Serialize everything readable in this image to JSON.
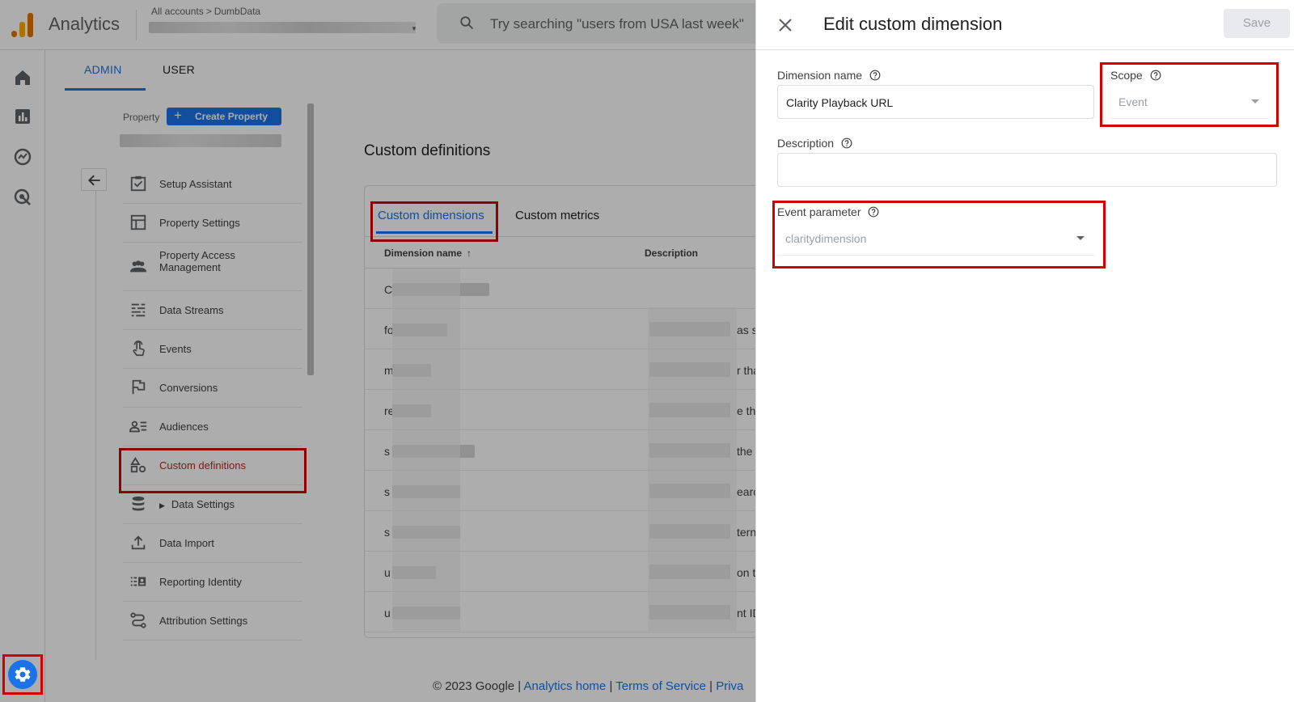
{
  "app": {
    "title": "Analytics",
    "breadcrumb": [
      "All accounts",
      "DumbData"
    ],
    "breadcrumb_sep": ">",
    "search_placeholder": "Try searching \"users from USA last week\""
  },
  "admin_tabs": [
    "ADMIN",
    "USER"
  ],
  "property": {
    "label": "Property",
    "create_button": "Create Property"
  },
  "nav": {
    "items": [
      {
        "label": "Setup Assistant",
        "icon": "checklist-icon"
      },
      {
        "label": "Property Settings",
        "icon": "property-settings-icon"
      },
      {
        "label": "Property Access\nManagement",
        "icon": "people-icon"
      },
      {
        "label": "Data Streams",
        "icon": "data-streams-icon"
      },
      {
        "label": "Events",
        "icon": "touch-icon"
      },
      {
        "label": "Conversions",
        "icon": "flag-icon"
      },
      {
        "label": "Audiences",
        "icon": "audiences-icon"
      },
      {
        "label": "Custom definitions",
        "icon": "shapes-icon"
      },
      {
        "label": "Data Settings",
        "icon": "database-icon"
      },
      {
        "label": "Data Import",
        "icon": "upload-icon"
      },
      {
        "label": "Reporting Identity",
        "icon": "reporting-identity-icon"
      },
      {
        "label": "Attribution Settings",
        "icon": "attribution-icon"
      }
    ]
  },
  "custom_definitions": {
    "title": "Custom definitions",
    "tabs": [
      "Custom dimensions",
      "Custom metrics"
    ],
    "columns": [
      "Dimension name",
      "Description"
    ],
    "rows": [
      {
        "name": "C",
        "desc": ""
      },
      {
        "name": "fo",
        "desc": "as s"
      },
      {
        "name": "m",
        "desc": "r tha"
      },
      {
        "name": "re",
        "desc": "e th"
      },
      {
        "name": "s",
        "desc": "the"
      },
      {
        "name": "s",
        "desc": "earc"
      },
      {
        "name": "s",
        "desc": "tern"
      },
      {
        "name": "u",
        "desc": "on t"
      },
      {
        "name": "u",
        "desc": "nt ID"
      }
    ]
  },
  "footer": {
    "copyright": "© 2023 Google |",
    "links": [
      "Analytics home",
      "Terms of Service",
      "Priva"
    ],
    "sep": "|"
  },
  "panel": {
    "title": "Edit custom dimension",
    "save_label": "Save",
    "dimension_name_label": "Dimension name",
    "dimension_name_value": "Clarity Playback URL",
    "scope_label": "Scope",
    "scope_value": "Event",
    "description_label": "Description",
    "description_value": "",
    "event_parameter_label": "Event parameter",
    "event_parameter_value": "claritydimension"
  },
  "colors": {
    "accent": "#1a73e8",
    "highlight": "#d40000",
    "active_nav": "#c5221f"
  }
}
